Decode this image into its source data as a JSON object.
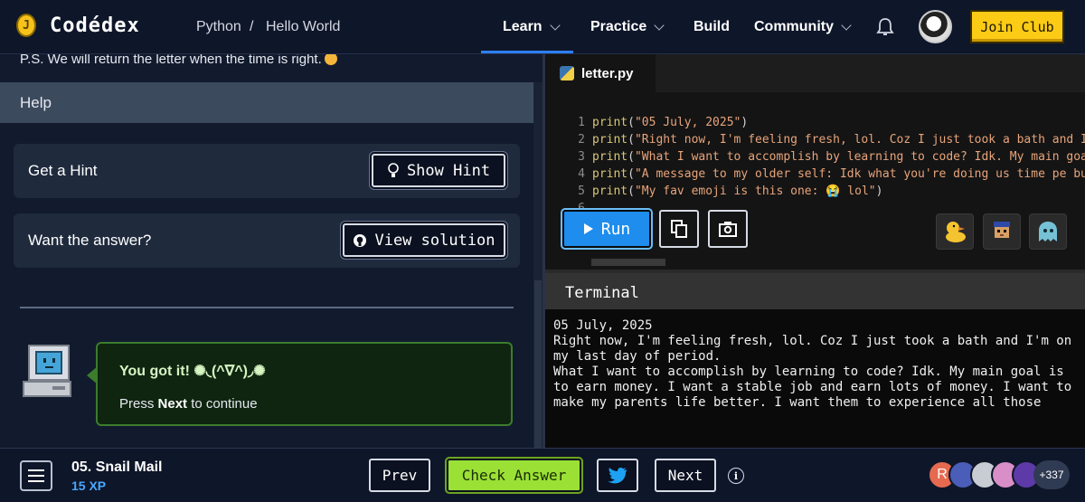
{
  "nav": {
    "logo_letter": "J",
    "brand": "Codédex",
    "breadcrumb": [
      "Python",
      "/",
      "Hello World"
    ],
    "items": [
      {
        "label": "Learn",
        "has_chevron": true,
        "active": true
      },
      {
        "label": "Practice",
        "has_chevron": true
      },
      {
        "label": "Build",
        "has_chevron": false
      },
      {
        "label": "Community",
        "has_chevron": true
      }
    ],
    "join_label": "Join Club",
    "accent": "#2d7ff5",
    "join_color": "#fbcb16"
  },
  "left": {
    "ps_text": "P.S. We will return the letter when the time is right.",
    "help_title": "Help",
    "hint_label": "Get a Hint",
    "hint_button": "Show Hint",
    "answer_label": "Want the answer?",
    "solution_button": "View solution",
    "toast_title": "You got it! ✺◟(^∇^)◞✺",
    "toast_pre": "Press ",
    "toast_bold": "Next",
    "toast_post": " to continue",
    "toast_border": "#3c7d2c"
  },
  "editor": {
    "filename": "letter.py",
    "lines": [
      {
        "n": "1",
        "fn": "print",
        "str": "\"05 July, 2025\"",
        "tail": ")"
      },
      {
        "n": "2",
        "fn": "print",
        "str": "\"Right now, I'm feeling fresh, lol. Coz I just took a bath and I'm ",
        "tail": ""
      },
      {
        "n": "3",
        "fn": "print",
        "str": "\"What I want to accomplish by learning to code? Idk. My main goal i",
        "tail": ""
      },
      {
        "n": "4",
        "fn": "print",
        "str": "\"A message to my older self: Idk what you're doing us time pe but I",
        "tail": ""
      },
      {
        "n": "5",
        "fn": "print",
        "str": "\"My fav emoji is this one: 😭 lol\"",
        "tail": ")"
      },
      {
        "n": "6",
        "fn": "",
        "str": "",
        "tail": ""
      }
    ],
    "run_label": "Run",
    "run_color": "#1f8ded"
  },
  "terminal": {
    "title": "Terminal",
    "output": "05 July, 2025\nRight now, I'm feeling fresh, lol. Coz I just took a bath and I'm on my last day of period.\nWhat I want to accomplish by learning to code? Idk. My main goal is to earn money. I want a stable job and earn lots of money. I want to make my parents life better. I want them to experience all those"
  },
  "footer": {
    "lesson": "05. Snail Mail",
    "xp": "15 XP",
    "prev": "Prev",
    "check": "Check Answer",
    "next": "Next",
    "info": "i",
    "first_avatar_letter": "R",
    "count": "+337",
    "check_color": "#9ae035"
  }
}
